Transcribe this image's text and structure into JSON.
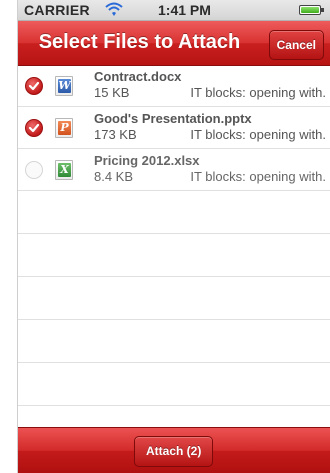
{
  "status_bar": {
    "carrier": "CARRIER",
    "time": "1:41 PM",
    "wifi_icon": "wifi-icon",
    "battery_icon": "battery-icon",
    "battery_level": 1.0
  },
  "nav": {
    "title": "Select Files to Attach",
    "cancel_label": "Cancel"
  },
  "files": [
    {
      "name": "Contract.docx",
      "size": "15 KB",
      "description": "IT blocks: opening with.",
      "type_icon": "word-document-icon",
      "selected": true
    },
    {
      "name": "Good's Presentation.pptx",
      "size": "173 KB",
      "description": "IT blocks: opening with.",
      "type_icon": "powerpoint-document-icon",
      "selected": true
    },
    {
      "name": "Pricing 2012.xlsx",
      "size": "8.4 KB",
      "description": "IT blocks: opening with.",
      "type_icon": "excel-document-icon",
      "selected": false
    }
  ],
  "toolbar": {
    "attach_label": "Attach (2)"
  },
  "colors": {
    "accent": "#d32a2a",
    "nav_dark": "#b71414"
  }
}
